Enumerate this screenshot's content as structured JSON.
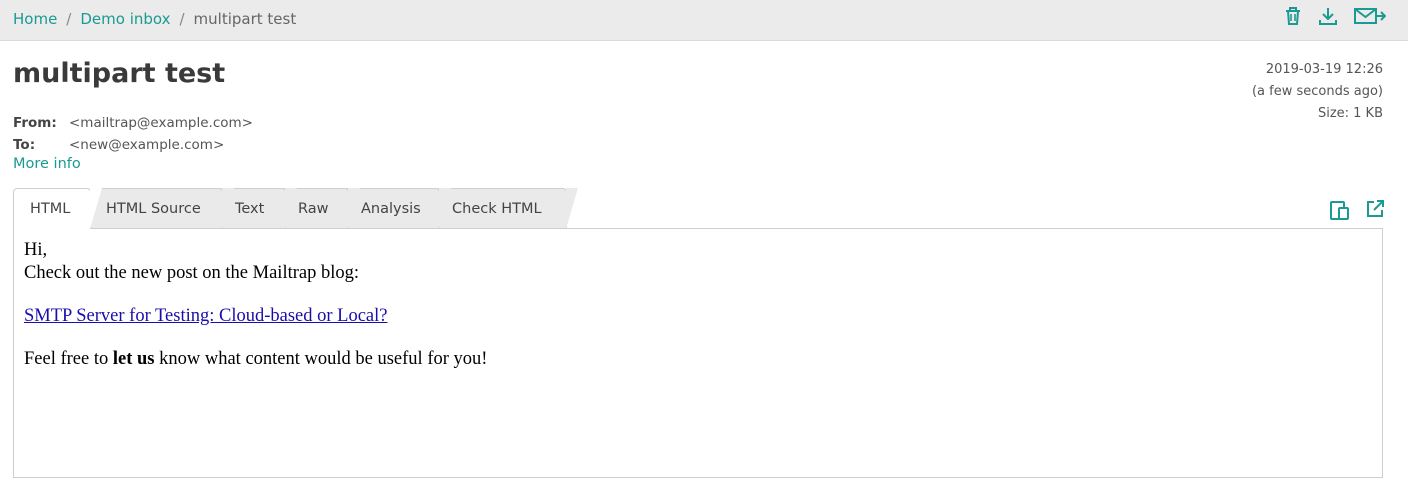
{
  "breadcrumb": {
    "home": "Home",
    "inbox": "Demo inbox",
    "current": "multipart test",
    "sep": "/"
  },
  "toolbar": {
    "icons": [
      "trash-icon",
      "download-icon",
      "forward-icon"
    ]
  },
  "message": {
    "subject": "multipart test",
    "date": "2019-03-19 12:26",
    "relative": "(a few seconds ago)",
    "size": "Size: 1 KB",
    "from_label": "From:",
    "from": "<mailtrap@example.com>",
    "to_label": "To:",
    "to": "<new@example.com>",
    "more_info": "More info"
  },
  "tabs": [
    {
      "label": "HTML"
    },
    {
      "label": "HTML Source"
    },
    {
      "label": "Text"
    },
    {
      "label": "Raw"
    },
    {
      "label": "Analysis"
    },
    {
      "label": "Check HTML"
    }
  ],
  "body": {
    "greeting": "Hi,",
    "line1": "Check out the new post on the Mailtrap blog:",
    "link": "SMTP Server for Testing: Cloud-based or Local?",
    "line2_pre": "Feel free to ",
    "line2_bold": "let us",
    "line2_post": " know what content would be useful for you!"
  },
  "colors": {
    "accent": "#1a9a93",
    "link": "#1a0dab",
    "topbar": "#ebebeb"
  }
}
